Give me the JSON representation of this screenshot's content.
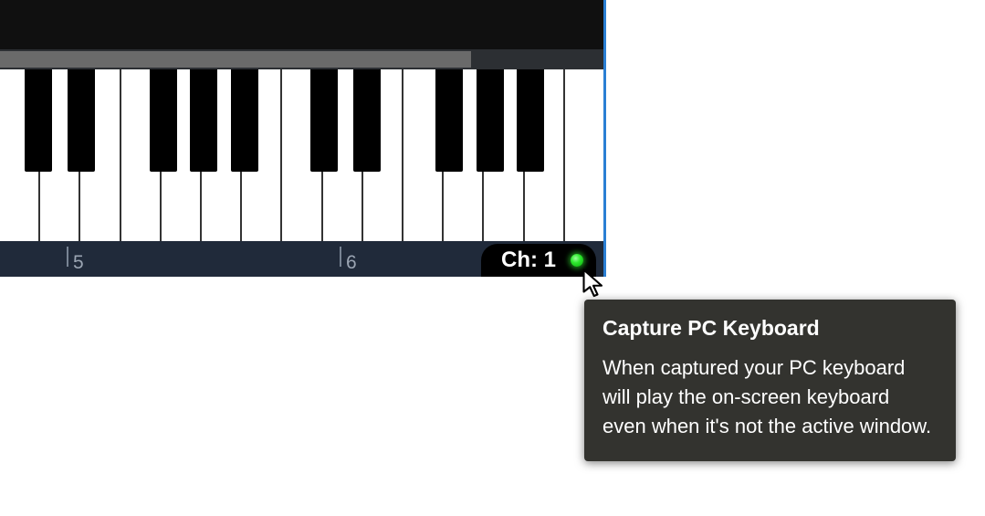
{
  "ruler": {
    "tick1_label": "5",
    "tick2_label": "6"
  },
  "channel": {
    "label": "Ch: 1"
  },
  "tooltip": {
    "title": "Capture PC Keyboard",
    "body": "When captured your PC keyboard will play the on-screen keyboard even when it's not the active window."
  },
  "keyboard": {
    "white_key_count": 15,
    "black_key_positions_pct": [
      4.1,
      11.2,
      24.8,
      31.5,
      38.2,
      51.5,
      58.6,
      72.2,
      78.9,
      85.6
    ]
  }
}
